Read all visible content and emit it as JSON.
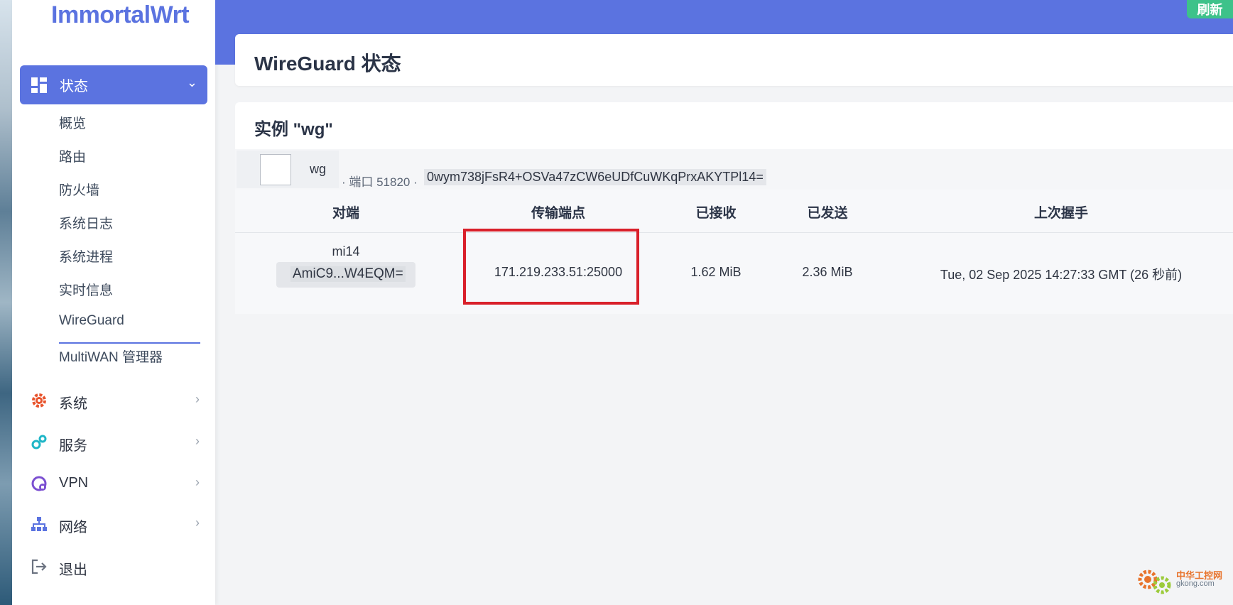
{
  "sidebar": {
    "logo": "ImmortalWrt",
    "active_menu": {
      "label": "状态",
      "icon": "dashboard-icon"
    },
    "sub_items": [
      "概览",
      "路由",
      "防火墙",
      "系统日志",
      "系统进程",
      "实时信息",
      "WireGuard",
      "MultiWAN 管理器"
    ],
    "active_sub_index": 6,
    "groups": [
      {
        "label": "系统",
        "icon": "gear-icon",
        "color": "#e8542d"
      },
      {
        "label": "服务",
        "icon": "services-icon",
        "color": "#1fb6c7"
      },
      {
        "label": "VPN",
        "icon": "vpn-icon",
        "color": "#7b4fd1"
      },
      {
        "label": "网络",
        "icon": "network-icon",
        "color": "#5b73e0"
      },
      {
        "label": "退出",
        "icon": "logout-icon",
        "color": "#6b7280"
      }
    ]
  },
  "header": {
    "refresh_label": "刷新",
    "page_title": "WireGuard 状态"
  },
  "instance": {
    "title": "实例 \"wg\"",
    "iface_name": "wg",
    "port_text": "· 端口 51820 ·",
    "public_key": "0wym738jFsR4+OSVa47zCW6eUDfCuWKqPrxAKYTPl14="
  },
  "table": {
    "columns": [
      "对端",
      "传输端点",
      "已接收",
      "已发送",
      "上次握手"
    ],
    "rows": [
      {
        "peer_name": "mi14",
        "peer_key": "AmiC9...W4EQM=",
        "endpoint": "171.219.233.51:25000",
        "received": "1.62 MiB",
        "sent": "2.36 MiB",
        "handshake": "Tue, 02 Sep 2025 14:27:33 GMT (26 秒前)"
      }
    ]
  },
  "watermark": {
    "title": "中华工控网",
    "url": "gkong.com"
  },
  "colors": {
    "accent": "#5b73e0",
    "refresh": "#3dc28a",
    "highlight": "#d9202a"
  }
}
